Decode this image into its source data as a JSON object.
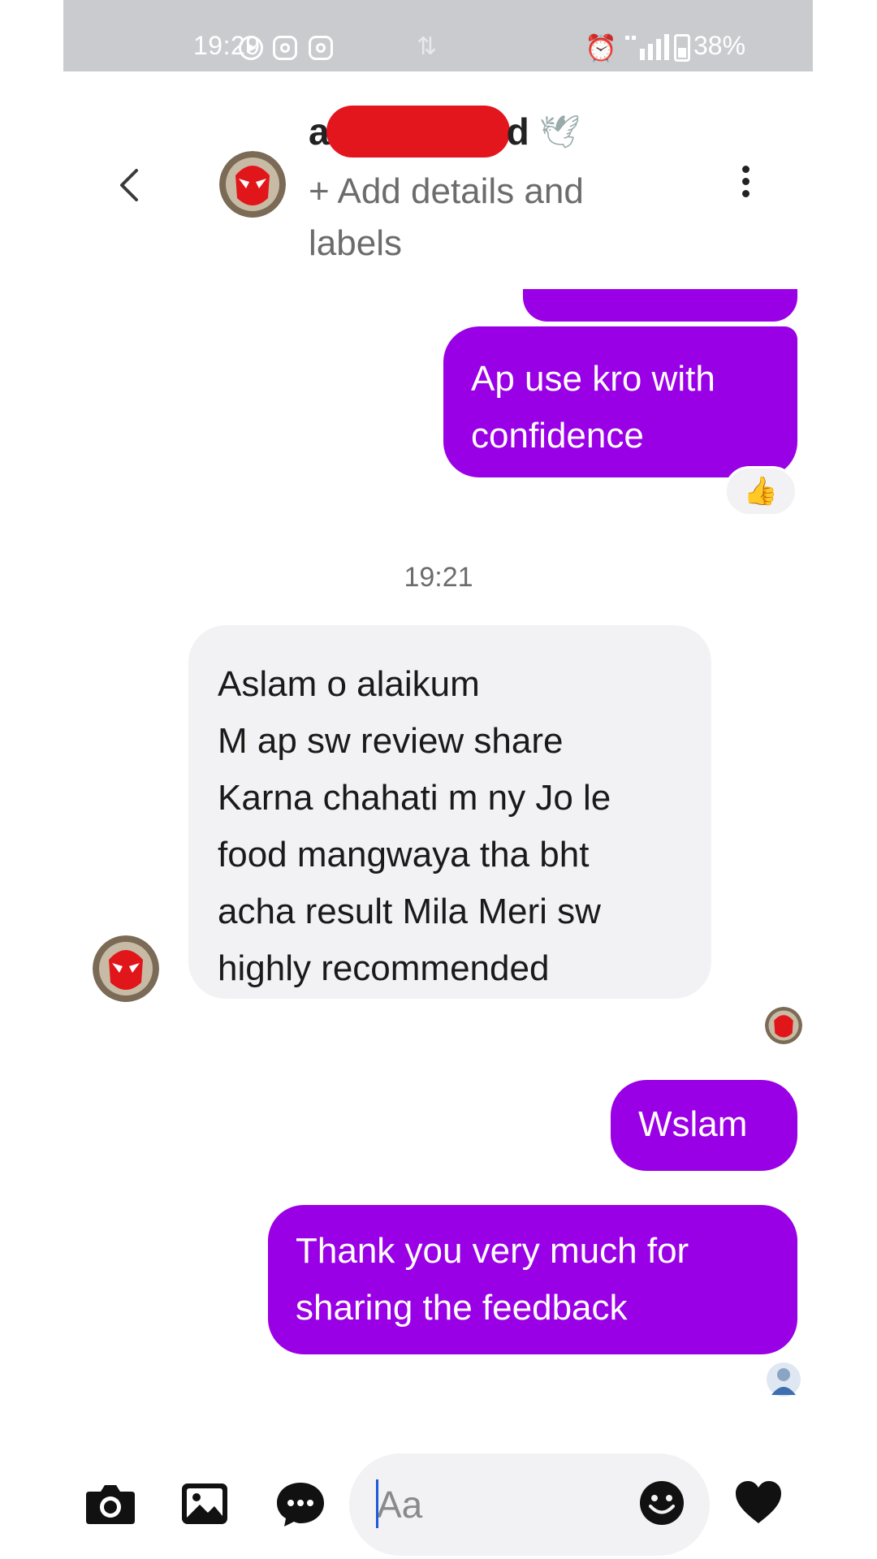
{
  "status_bar": {
    "time": "19:29",
    "battery_text": "38%",
    "icons": [
      "messenger-icon",
      "instagram-icon",
      "instagram-icon",
      "sync-icon",
      "alarm-icon",
      "signal-icon",
      "battery-icon"
    ]
  },
  "header": {
    "back_icon": "chevron-left-icon",
    "name_first": "a",
    "name_last": "d",
    "name_emoji": "dove-icon",
    "subtitle": "+ Add details and labels",
    "more_icon": "more-vertical-icon"
  },
  "messages": {
    "ap_use": "Ap use kro with confidence",
    "reaction": "thumbs-up-icon",
    "timestamp": "19:21",
    "review_lines": [
      "Aslam o alaikum",
      "M ap sw review share",
      "Karna chahati m ny Jo le",
      "food mangwaya tha bht",
      "acha result Mila Meri sw",
      "highly recommended"
    ],
    "wslam": "Wslam",
    "thanks": "Thank you very much for sharing the feedback"
  },
  "composer": {
    "placeholder": "Aa",
    "icons": [
      "camera-icon",
      "gallery-icon",
      "chat-bubble-icon",
      "emoji-icon",
      "heart-icon"
    ]
  },
  "colors": {
    "outgoing_bubble": "#9a00e6",
    "incoming_bubble": "#f2f2f4",
    "status_bar": "#c9cbce",
    "redaction": "#e2161c"
  }
}
